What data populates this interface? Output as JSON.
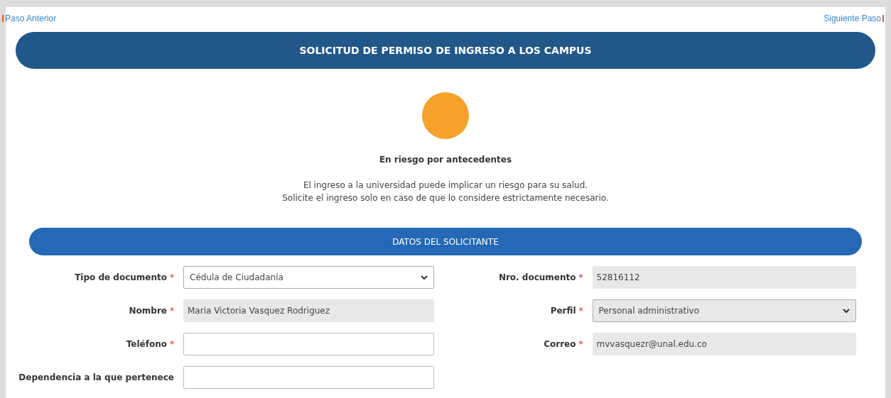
{
  "nav": {
    "previous": "Paso Anterior",
    "next": "Siguiente Paso"
  },
  "title": "SOLICITUD DE PERMISO DE INGRESO A LOS CAMPUS",
  "status": {
    "color": "#f5a12a",
    "label": "En riesgo por antecedentes",
    "message": [
      "El ingreso a la universidad puede implicar un riesgo para su salud.",
      "Solicite el ingreso solo en caso de que lo considere estrictamente necesario."
    ]
  },
  "section": {
    "title": "DATOS DEL SOLICITANTE",
    "fields": [
      {
        "label": "Tipo de documento",
        "asterisk": "*",
        "kind": "select",
        "value": "Cédula de Ciudadanía",
        "disabled": false
      },
      {
        "label": "Nro. documento",
        "asterisk": "*",
        "kind": "text",
        "value": "52816112",
        "disabled": true
      },
      {
        "label": "Nombre",
        "asterisk": "*",
        "kind": "text",
        "value": "Maria Victoria Vasquez Rodriguez",
        "disabled": true
      },
      {
        "label": "Perfil",
        "asterisk": "*",
        "kind": "select",
        "value": "Personal administrativo",
        "disabled": true
      },
      {
        "label": "Teléfono",
        "asterisk": "*",
        "kind": "text",
        "disabled": false
      },
      {
        "label": "Correo",
        "asterisk": "*",
        "kind": "text",
        "value": "mvvasquezr@unal.edu.co",
        "disabled": true
      },
      {
        "label": "Dependencia a la que pertenece",
        "kind": "text",
        "disabled": false
      }
    ]
  }
}
